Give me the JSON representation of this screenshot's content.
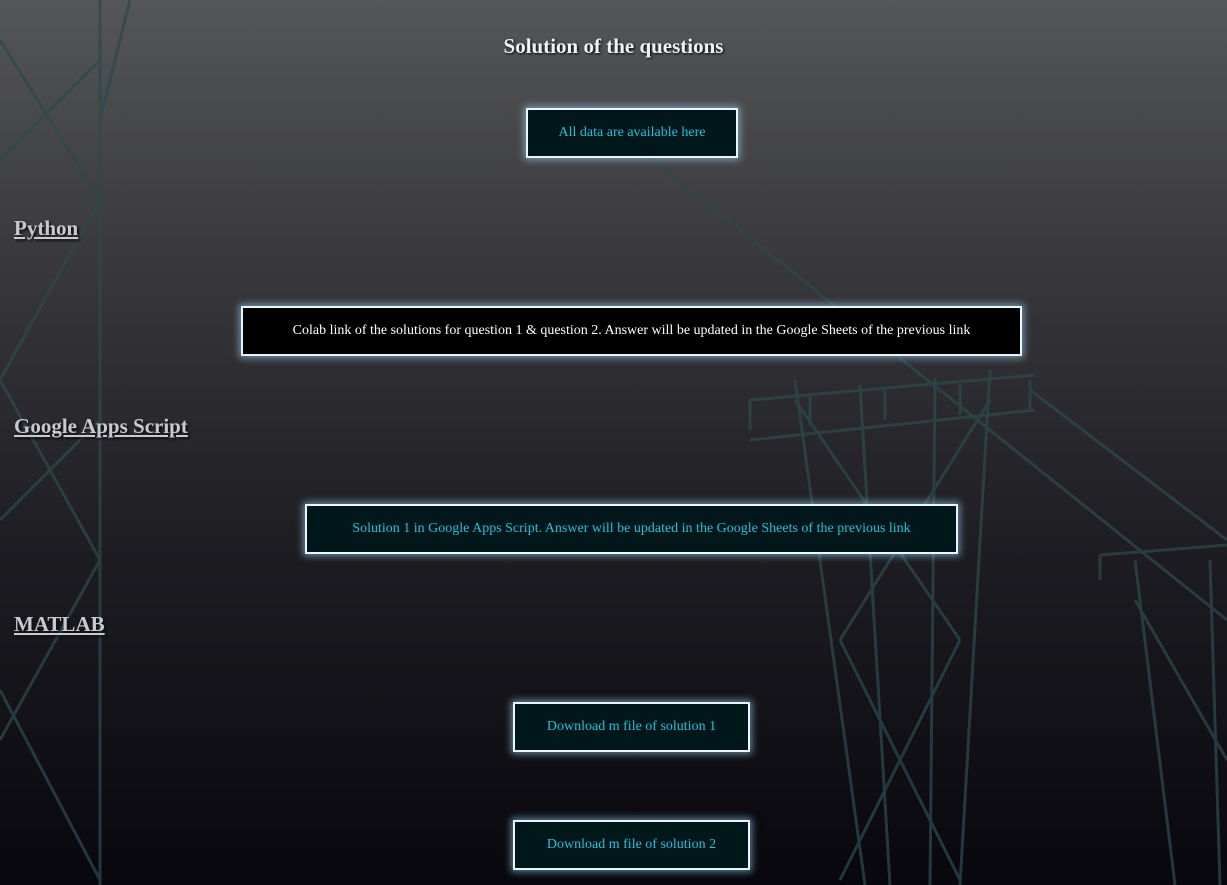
{
  "page": {
    "title": "Solution of the questions"
  },
  "buttons": {
    "all_data": "All data are available here",
    "colab": "Colab link of the solutions for question 1 & question 2. Answer will be updated in the Google Sheets of the previous link",
    "gas_solution": "Solution 1 in Google Apps Script. Answer will be updated in the Google Sheets of the previous link",
    "matlab_1": "Download m file of solution 1",
    "matlab_2": "Download m file of solution 2"
  },
  "sections": {
    "python": "Python",
    "google_apps_script": "Google Apps Script",
    "matlab": "MATLAB"
  },
  "colors": {
    "accent_text": "#1ec3e0",
    "button_border": "#e8f6ff",
    "background_top": "#555658",
    "background_bottom": "#07070d"
  }
}
